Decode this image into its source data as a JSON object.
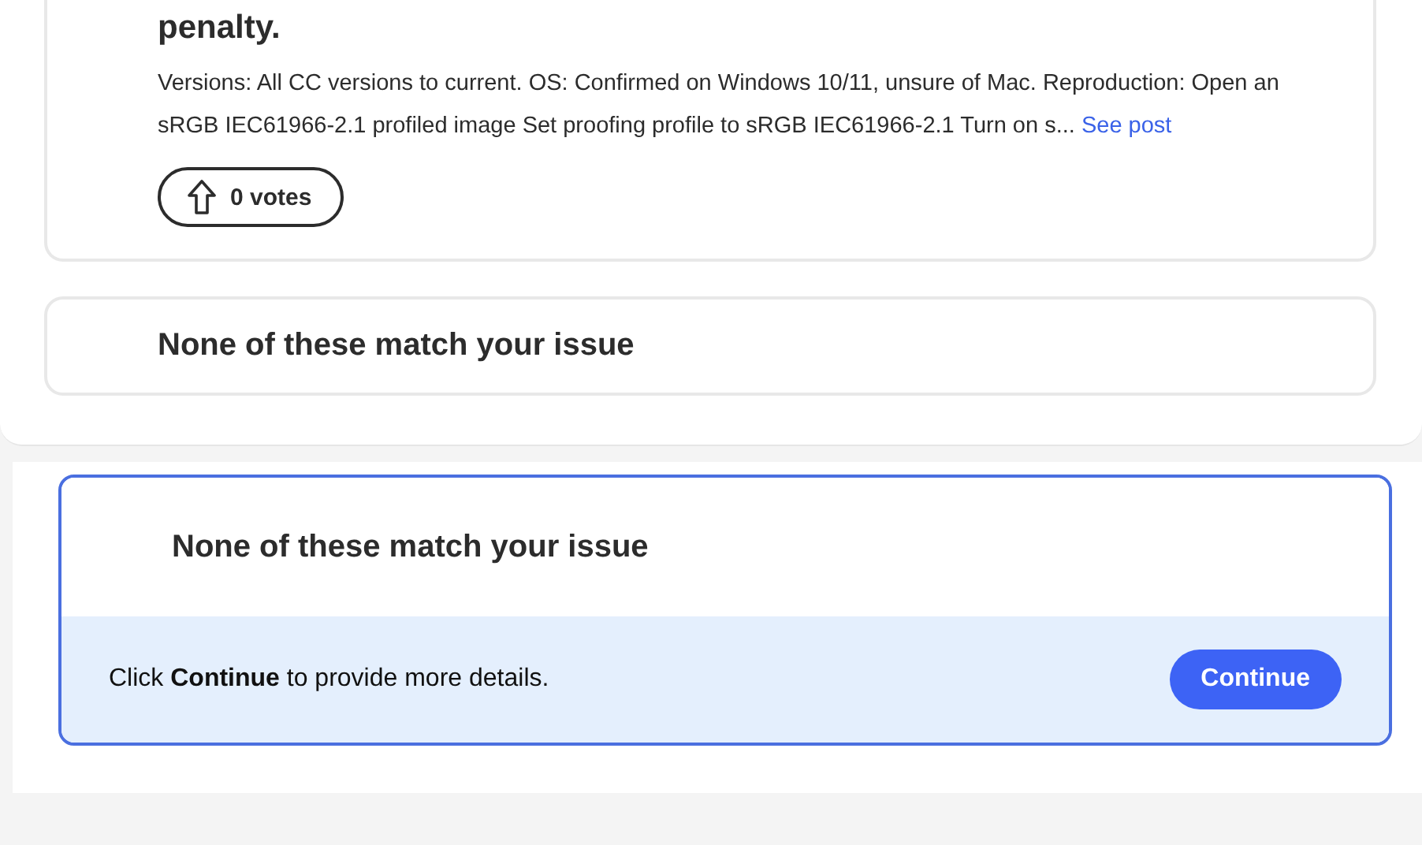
{
  "results": [
    {
      "kind": "post",
      "title": "penalty.",
      "description": "Versions: All CC versions to current. OS: Confirmed on Windows 10/11, unsure of Mac. Reproduction: Open an sRGB IEC61966-2.1 profiled image Set proofing profile to sRGB IEC61966-2.1 Turn on s...",
      "link": "See post",
      "votes": "0 votes"
    },
    {
      "kind": "none",
      "title": "None of these match your issue"
    }
  ],
  "selected_option": {
    "title": "None of these match your issue",
    "prompt": "Click **Continue** to provide more details.",
    "button": "Continue"
  }
}
